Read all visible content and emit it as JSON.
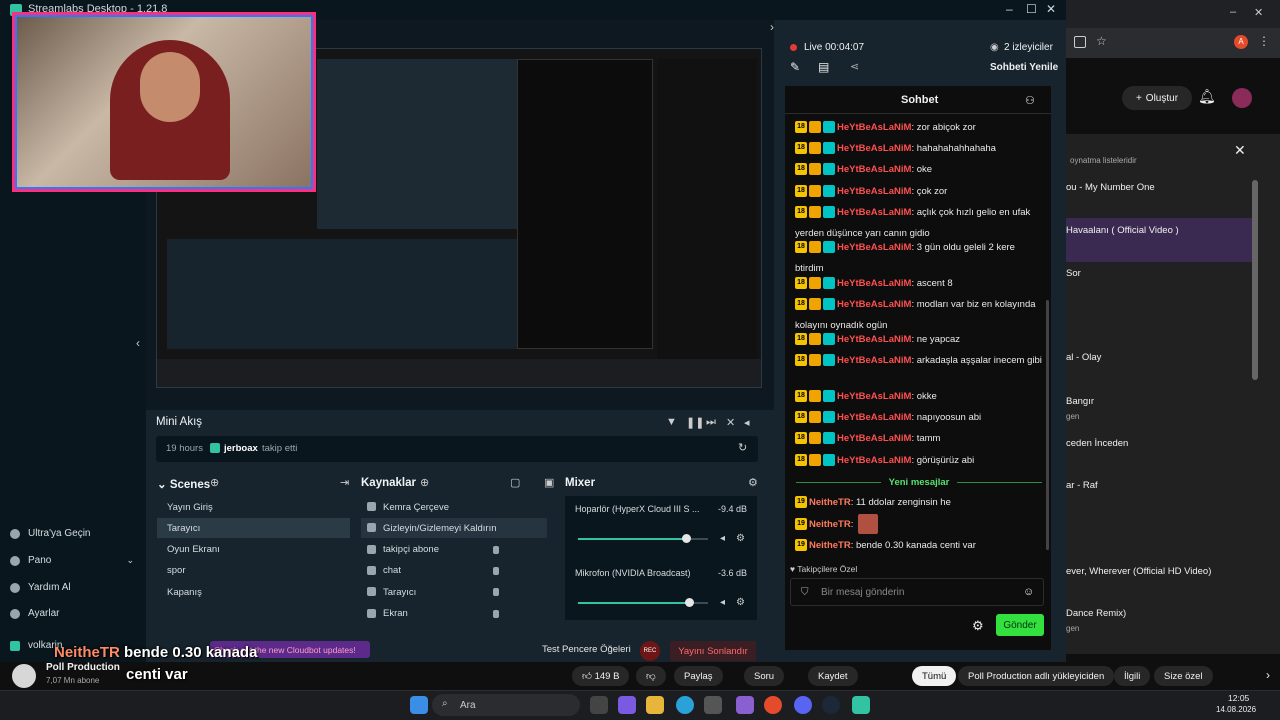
{
  "window": {
    "title": "Streamlabs Desktop - 1.21.8",
    "minimize": "–",
    "maximize": "☐",
    "close": "✕"
  },
  "sidebar": {
    "items": [
      {
        "label": "Ultra'ya Geçin",
        "icon": "ultra-icon"
      },
      {
        "label": "Pano",
        "icon": "dashboard-icon"
      },
      {
        "label": "Yardım Al",
        "icon": "help-icon"
      },
      {
        "label": "Ayarlar",
        "icon": "settings-icon"
      }
    ],
    "user": "volkarin"
  },
  "mini_feed": {
    "title": "Mini Akış",
    "time": "19 hours",
    "user": "jerboax",
    "event": "takip etti"
  },
  "scenes": {
    "title": "Scenes",
    "items": [
      "Yayın Giriş",
      "Tarayıcı",
      "Oyun Ekranı",
      "spor",
      "Kapanış"
    ],
    "selected": 1
  },
  "sources": {
    "title": "Kaynaklar",
    "items": [
      "Kemra Çerçeve",
      "Gizleyin/Gizlemeyi Kaldırın",
      "takipçi abone",
      "chat",
      "Tarayıcı",
      "Ekran"
    ],
    "selected": 1
  },
  "mixer": {
    "title": "Mixer",
    "channels": [
      {
        "name": "Hoparlör (HyperX Cloud III S ...",
        "db": "-9.4 dB",
        "level": 0.83
      },
      {
        "name": "Mikrofon (NVIDIA Broadcast)",
        "db": "-3.6 dB",
        "level": 0.85
      }
    ]
  },
  "footer": {
    "cloudbot": "Check out the new Cloudbot updates!",
    "test": "Test Pencere Öğeleri",
    "rec": "REC",
    "end": "Yayını Sonlandır"
  },
  "chat_pane": {
    "live": "Live 00:04:07",
    "viewers": "2 izleyiciler",
    "refresh": "Sohbeti Yenile",
    "title": "Sohbet",
    "messages": [
      {
        "badge": "18",
        "user": "HeYtBeAsLaNiM",
        "text": ": zor abiçok zor"
      },
      {
        "badge": "18",
        "user": "HeYtBeAsLaNiM",
        "text": ": hahahahahhahaha"
      },
      {
        "badge": "18",
        "user": "HeYtBeAsLaNiM",
        "text": ": oke"
      },
      {
        "badge": "18",
        "user": "HeYtBeAsLaNiM",
        "text": ": çok zor"
      },
      {
        "badge": "18",
        "user": "HeYtBeAsLaNiM",
        "text": ": açlık çok hızlı gelio en ufak yerden düşünce yarı canın gidio"
      },
      {
        "badge": "18",
        "user": "HeYtBeAsLaNiM",
        "text": ": 3 gün oldu geleli 2 kere btirdim"
      },
      {
        "badge": "18",
        "user": "HeYtBeAsLaNiM",
        "text": ": ascent 8"
      },
      {
        "badge": "18",
        "user": "HeYtBeAsLaNiM",
        "text": ": modları var biz en kolayında kolayını oynadık ogün"
      },
      {
        "badge": "18",
        "user": "HeYtBeAsLaNiM",
        "text": ": ne yapcaz"
      },
      {
        "badge": "18",
        "user": "HeYtBeAsLaNiM",
        "text": ": arkadaşla aşşalar inecem gibi"
      },
      {
        "badge": "18",
        "user": "HeYtBeAsLaNiM",
        "text": ": okke"
      },
      {
        "badge": "18",
        "user": "HeYtBeAsLaNiM",
        "text": ": napıyoosun abi"
      },
      {
        "badge": "18",
        "user": "HeYtBeAsLaNiM",
        "text": ": tamm"
      },
      {
        "badge": "18",
        "user": "HeYtBeAsLaNiM",
        "text": ": görüşürüz abi"
      }
    ],
    "new_messages": "Yeni mesajlar",
    "new": [
      {
        "badge": "19",
        "user": "NeitheTR",
        "text": ": 11 ddolar zenginsin he"
      },
      {
        "badge": "19",
        "user": "NeitheTR",
        "text": ":"
      },
      {
        "badge": "19",
        "user": "NeitheTR",
        "text": ": bende 0.30 kanada centi var"
      }
    ],
    "followers_only": "Takipçilere Özel",
    "placeholder": "Bir mesaj gönderin",
    "send": "Gönder"
  },
  "overlay": {
    "name": "NeitheTR",
    "text": "bende 0.30 kanada",
    "text2": "centi var"
  },
  "youtube": {
    "create": "Oluştur",
    "playlist_hint": "oynatma listeleridir",
    "items": [
      "ou - My Number One",
      "Havaalanı ( Official Video )",
      "Sor",
      "al - Olay",
      "Bangır",
      "gen",
      "ceden İnceden",
      "ar - Raf",
      "ever, Wherever (Official HD Video)",
      "Dance Remix)",
      "gen"
    ],
    "channel": "Poll Production",
    "subs": "7,07 Mn abone",
    "likes": "149 B",
    "share": "Paylaş",
    "ask": "Soru",
    "save": "Kaydet",
    "chips": [
      "Tümü",
      "Poll Production adlı yükleyiciden",
      "İlgili",
      "Size özel"
    ]
  },
  "taskbar": {
    "search": "Ara",
    "time": "12:05",
    "date": "14.08.2026"
  }
}
